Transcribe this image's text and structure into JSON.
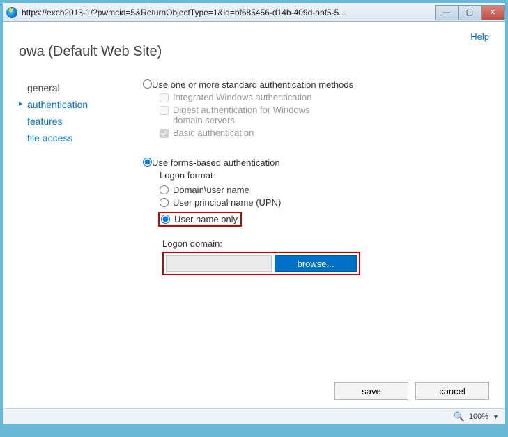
{
  "titlebar": {
    "url": "https://exch2013-1/?pwmcid=5&ReturnObjectType=1&id=bf685456-d14b-409d-abf5-5..."
  },
  "header": {
    "help": "Help",
    "title": "owa (Default Web Site)"
  },
  "nav": {
    "general": "general",
    "authentication": "authentication",
    "features": "features",
    "file_access": "file access"
  },
  "auth": {
    "std_label": "Use one or more standard authentication methods",
    "iwa": "Integrated Windows authentication",
    "digest": "Digest authentication for Windows domain servers",
    "basic": "Basic authentication",
    "forms_label": "Use forms-based authentication",
    "logon_format": "Logon format:",
    "opt_domain_user": "Domain\\user name",
    "opt_upn": "User principal name (UPN)",
    "opt_username_only": "User name only",
    "logon_domain": "Logon domain:",
    "domain_value": "",
    "browse": "browse..."
  },
  "footer": {
    "save": "save",
    "cancel": "cancel"
  },
  "status": {
    "zoom": "100%"
  }
}
